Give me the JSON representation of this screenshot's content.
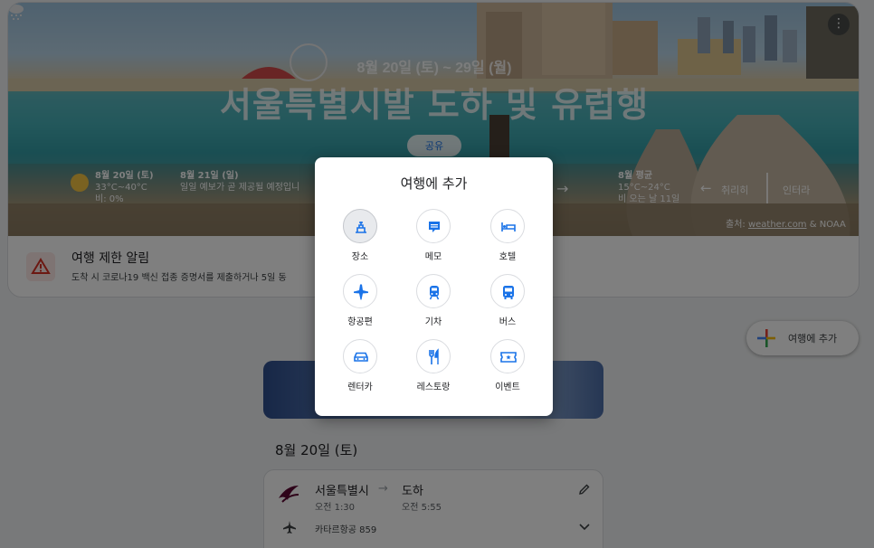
{
  "hero": {
    "dates": "8월 20일 (토) ~ 29일 (월)",
    "title": "서울특별시발 도하 및 유럽행",
    "share_label": "공유",
    "more_label": "⋮",
    "weather": [
      {
        "date": "8월 20일 (토)",
        "temp": "33°C~40°C",
        "extra": "비: 0%"
      },
      {
        "date": "8월 21일 (일)",
        "temp": "일일 예보가 곧 제공될 예정입니",
        "extra": ""
      },
      {
        "date": "8월 평균",
        "temp": "15°C~24°C",
        "extra": "비 오는 날 11일"
      }
    ],
    "cancel_label": "취리히",
    "interrupt_label": "인터라",
    "source_prefix": "출처: ",
    "source_link": "weather.com",
    "source_suffix": " & NOAA"
  },
  "alert": {
    "title": "여행 제한 알림",
    "desc": "도착 시 코로나19 백신 접종 증명서를 제출하거나 5일 동"
  },
  "modal": {
    "title": "여행에 추가",
    "options": [
      {
        "label": "장소",
        "icon": "place-icon"
      },
      {
        "label": "메모",
        "icon": "note-icon"
      },
      {
        "label": "호텔",
        "icon": "hotel-icon"
      },
      {
        "label": "항공편",
        "icon": "flight-icon"
      },
      {
        "label": "기차",
        "icon": "train-icon"
      },
      {
        "label": "버스",
        "icon": "bus-icon"
      },
      {
        "label": "렌터카",
        "icon": "car-icon"
      },
      {
        "label": "레스토랑",
        "icon": "restaurant-icon"
      },
      {
        "label": "이벤트",
        "icon": "ticket-icon"
      }
    ]
  },
  "fab": {
    "label": "여행에 추가"
  },
  "day": {
    "title": "8월 20일 (토)"
  },
  "flight": {
    "from": "서울특별시",
    "to": "도하",
    "arrow": "→",
    "depart": "오전 1:30",
    "arrive": "오전 5:55",
    "number": "카타르항공 859"
  },
  "colors": {
    "accent": "#1a73e8",
    "alert": "#d93025",
    "airline": "#5c0632"
  }
}
